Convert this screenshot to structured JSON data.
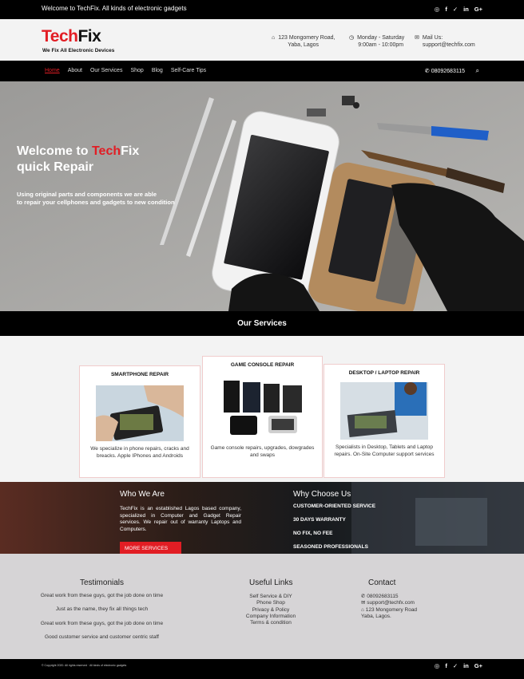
{
  "topbar": {
    "message": "Welcome to TechFix. All kinds of electronic gadgets",
    "social": [
      {
        "icon": "instagram-icon",
        "glyph": "◎"
      },
      {
        "icon": "facebook-icon",
        "glyph": "f"
      },
      {
        "icon": "twitter-icon",
        "glyph": "✓"
      },
      {
        "icon": "linkedin-icon",
        "glyph": "in"
      },
      {
        "icon": "google-plus-icon",
        "glyph": "G+"
      }
    ]
  },
  "header": {
    "logo_tech": "Tech",
    "logo_fix": "Fix",
    "tagline": "We Fix All Electronic Devices",
    "address_line1": "123 Mongomery Road,",
    "address_line2": "Yaba, Lagos",
    "hours_line1": "Monday - Saturday",
    "hours_line2": "9:00am - 10:00pm",
    "mail_line1": "Mail Us:",
    "mail_line2": "support@techfix.com"
  },
  "nav": {
    "items": [
      "Home",
      "About",
      "Our Services",
      "Shop",
      "Blog",
      "Self-Care Tips"
    ],
    "active": "Home",
    "phone": "08092683115"
  },
  "hero": {
    "title_prefix": "Welcome to ",
    "title_tech": "Tech",
    "title_fix": "Fix",
    "title_line2": "quick Repair",
    "subtitle_line1": "Using original parts and components we are able",
    "subtitle_line2": "to repair your cellphones and gadgets to new condition"
  },
  "services": {
    "title": "Our Services",
    "cards": [
      {
        "title": "SMARTPHONE REPAIR",
        "desc": "We specialize in phone repairs, cracks and breacks. Apple IPhones and Androids"
      },
      {
        "title": "GAME CONSOLE REPAIR",
        "desc": "Game console repairs, upgrades, dowgrades and swaps"
      },
      {
        "title": "DESKTOP / LAPTOP REPAIR",
        "desc": "Specialists in Desktop, Tablets and Laptop repairs. On-Site Computer support services"
      }
    ]
  },
  "about": {
    "who_title": "Who We Are",
    "who_text": "TechFix is an established Lagos based company, specialized in Computer and Gadget Repair services. We repair out of warranty Laptops and Computers.",
    "button": "MORE SERVICES",
    "why_title": "Why Choose Us",
    "why_items": [
      "CUSTOMER-ORIENTED SERVICE",
      "30 DAYS WARRANTY",
      "NO FIX, NO FEE",
      "SEASONED PROFESSIONALS"
    ]
  },
  "footer": {
    "testimonials_title": "Testimonials",
    "testimonials": [
      "Great work from these guys, got the job done on time",
      "Just as the name, they fix all things tech",
      "Great work from these guys, got the job done on time",
      "Good customer service and customer centric staff"
    ],
    "links_title": "Useful Links",
    "links": [
      "Self Service & DIY",
      "Phone Shop",
      "Privacy & Policy",
      "Company Information",
      "Terms & condition"
    ],
    "contact_title": "Contact",
    "contact_phone": "08092683115",
    "contact_email": "support@techfx.com",
    "contact_addr1": "123 Mongomery Road",
    "contact_addr2": "Yaba, Lagos."
  },
  "bottombar": {
    "copyright": "© Copyright 2020. All rights reserved · All kinds of electronic gadgets"
  },
  "colors": {
    "accent": "#e21d24",
    "dark": "#000000"
  }
}
